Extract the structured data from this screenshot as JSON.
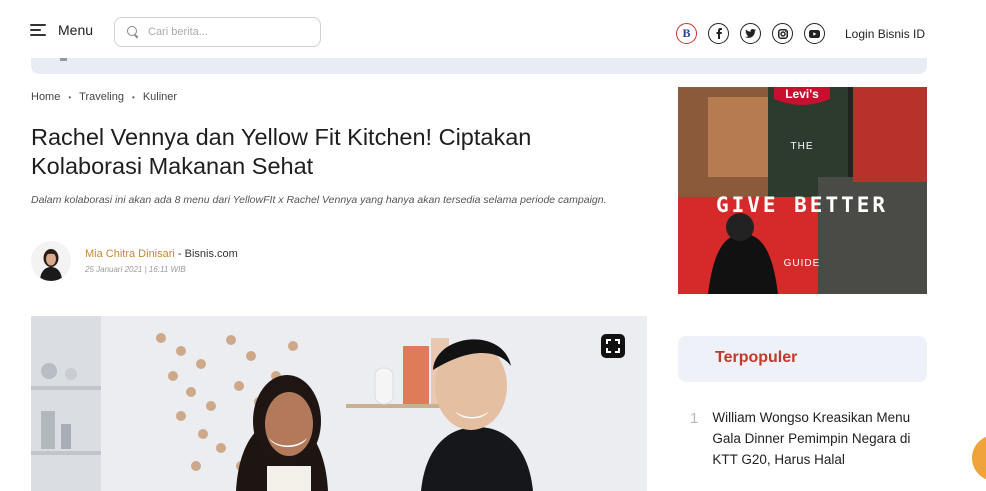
{
  "header": {
    "menu_label": "Menu",
    "search_placeholder": "Cari berita...",
    "login_label": "Login Bisnis ID",
    "social_icons": [
      "bisnis-icon",
      "facebook-icon",
      "twitter-icon",
      "instagram-icon",
      "youtube-icon"
    ]
  },
  "breadcrumb": [
    "Home",
    "Traveling",
    "Kuliner"
  ],
  "article": {
    "title": "Rachel Vennya dan Yellow Fit Kitchen! Ciptakan Kolaborasi Makanan Sehat",
    "summary": "Dalam kolaborasi ini akan ada 8 menu dari YellowFIt x Rachel Vennya yang hanya akan tersedia selama periode campaign.",
    "author_name": "Mia Chitra Dinisari",
    "author_source": " - Bisnis.com",
    "date": "25 Januari 2021  |  16:11 WIB"
  },
  "ad": {
    "brand": "Levi's",
    "line1": "THE",
    "line2": "GIVE BETTER",
    "line3": "GUIDE"
  },
  "sidebar": {
    "terpopuler_label": "Terpopuler",
    "items": [
      {
        "number": "1",
        "text": "William Wongso Kreasikan Menu Gala Dinner Pemimpin Negara di KTT G20, Harus Halal"
      }
    ]
  },
  "colors": {
    "accent_red": "#c0392b",
    "author_gold": "#c78a2e",
    "fab_orange": "#f0a33a",
    "strip_blue": "#e8edf5"
  }
}
